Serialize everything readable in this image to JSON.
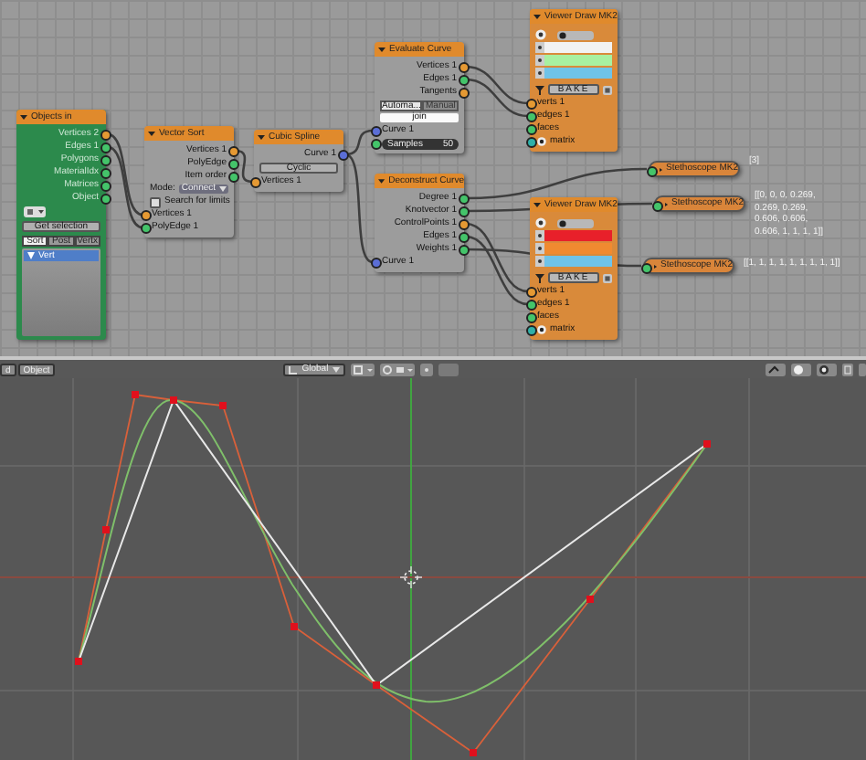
{
  "node_editor": {
    "nodes": [
      {
        "title": "Objects in",
        "kind": "objects_in",
        "rows": [
          {
            "kind": "out",
            "label": "Vertices 2",
            "color": "#e59933"
          },
          {
            "kind": "out",
            "label": "Edges 1",
            "color": "#44c46a"
          },
          {
            "kind": "out",
            "label": "Polygons",
            "color": "#44c46a"
          },
          {
            "kind": "out",
            "label": "MaterialIdx",
            "color": "#44c46a"
          },
          {
            "kind": "out",
            "label": "Matrices",
            "color": "#44c46a"
          },
          {
            "kind": "out",
            "label": "Object",
            "color": "#44c46a"
          },
          {
            "kind": "icon_dropdown"
          },
          {
            "kind": "button",
            "label": "Get selection"
          },
          {
            "kind": "tabs",
            "options": [
              {
                "label": "Sort",
                "selected": true
              },
              {
                "label": "Post",
                "selected": false
              },
              {
                "label": "Vertx",
                "selected": false
              }
            ]
          },
          {
            "kind": "list",
            "items": [
              {
                "label": "Vert",
                "selected": true
              }
            ]
          }
        ]
      },
      {
        "title": "Vector Sort",
        "kind": "standard",
        "rows": [
          {
            "kind": "out",
            "label": "Vertices 1",
            "color": "#e59933"
          },
          {
            "kind": "out",
            "label": "PolyEdge",
            "color": "#44c46a"
          },
          {
            "kind": "out",
            "label": "Item order",
            "color": "#44c46a"
          },
          {
            "kind": "dropdown",
            "label": "Mode:",
            "value": "Connect"
          },
          {
            "kind": "checkbox",
            "label": "Search for limits",
            "checked": false
          },
          {
            "kind": "in",
            "label": "Vertices 1",
            "color": "#e59933"
          },
          {
            "kind": "in",
            "label": "PolyEdge 1",
            "color": "#44c46a"
          }
        ]
      },
      {
        "title": "Cubic Spline",
        "kind": "standard",
        "rows": [
          {
            "kind": "out",
            "label": "Curve 1",
            "color": "#5b6ed6"
          },
          {
            "kind": "button",
            "label": "Cyclic"
          },
          {
            "kind": "in",
            "label": "Vertices 1",
            "color": "#e59933"
          }
        ]
      },
      {
        "title": "Evaluate Curve",
        "kind": "standard",
        "rows": [
          {
            "kind": "out",
            "label": "Vertices 1",
            "color": "#e59933"
          },
          {
            "kind": "out",
            "label": "Edges 1",
            "color": "#44c46a"
          },
          {
            "kind": "out",
            "label": "Tangents",
            "color": "#e59933"
          },
          {
            "kind": "toggle",
            "options": [
              {
                "label": "Automa...",
                "selected": true
              },
              {
                "label": "Manual",
                "selected": false
              }
            ]
          },
          {
            "kind": "field",
            "value": "join"
          },
          {
            "kind": "in",
            "label": "Curve 1",
            "color": "#5b6ed6"
          },
          {
            "kind": "slider",
            "label": "Samples",
            "value": "50",
            "color": "#44c46a"
          }
        ]
      },
      {
        "title": "Deconstruct Curve",
        "kind": "standard",
        "rows": [
          {
            "kind": "out",
            "label": "Degree 1",
            "color": "#44c46a"
          },
          {
            "kind": "out",
            "label": "Knotvector 1",
            "color": "#44c46a"
          },
          {
            "kind": "out",
            "label": "ControlPoints 1",
            "color": "#e59933"
          },
          {
            "kind": "out",
            "label": "Edges 1",
            "color": "#44c46a"
          },
          {
            "kind": "out",
            "label": "Weights 1",
            "color": "#44c46a"
          },
          {
            "kind": "in",
            "label": "Curve 1",
            "color": "#5b6ed6"
          }
        ]
      },
      {
        "title": "Viewer Draw MK2",
        "kind": "viewer",
        "rows": [
          {
            "kind": "viewer_header"
          },
          {
            "kind": "swatches",
            "items": [
              {
                "color": "#f2f2f2"
              },
              {
                "color": "#a8f0a0"
              },
              {
                "color": "#6fc3e8"
              }
            ]
          },
          {
            "kind": "bake",
            "label": "BAKE"
          },
          {
            "kind": "in",
            "label": "verts 1",
            "color": "#e59933"
          },
          {
            "kind": "in",
            "label": "edges 1",
            "color": "#44c46a"
          },
          {
            "kind": "in",
            "label": "faces",
            "color": "#44c46a"
          },
          {
            "kind": "matrix",
            "label": "matrix",
            "color": "#2fb0a8"
          }
        ]
      },
      {
        "title": "Viewer Draw MK2",
        "kind": "viewer",
        "rows": [
          {
            "kind": "viewer_header"
          },
          {
            "kind": "swatches",
            "items": [
              {
                "color": "#e8202a"
              },
              {
                "color": "#f08a30"
              },
              {
                "color": "#6fc3e8"
              }
            ]
          },
          {
            "kind": "bake",
            "label": "BAKE"
          },
          {
            "kind": "in",
            "label": "verts 1",
            "color": "#e59933"
          },
          {
            "kind": "in",
            "label": "edges 1",
            "color": "#44c46a"
          },
          {
            "kind": "in",
            "label": "faces",
            "color": "#44c46a"
          },
          {
            "kind": "matrix",
            "label": "matrix",
            "color": "#2fb0a8"
          }
        ]
      }
    ],
    "stethoscopes": [
      {
        "title": "Stethoscope MK2",
        "readout": [
          "[3]"
        ]
      },
      {
        "title": "Stethoscope MK2",
        "readout": [
          "[[0, 0, 0, 0.269,",
          "0.269, 0.269,",
          "0.606, 0.606,",
          "0.606, 1, 1, 1, 1]]"
        ]
      },
      {
        "title": "Stethoscope MK2",
        "readout": [
          "[[1, 1, 1, 1, 1, 1, 1, 1, 1]]"
        ]
      }
    ]
  },
  "viewport": {
    "header": {
      "buttons": [
        {
          "label": "d"
        },
        {
          "label": "Object"
        }
      ],
      "orientation": "Global"
    }
  }
}
